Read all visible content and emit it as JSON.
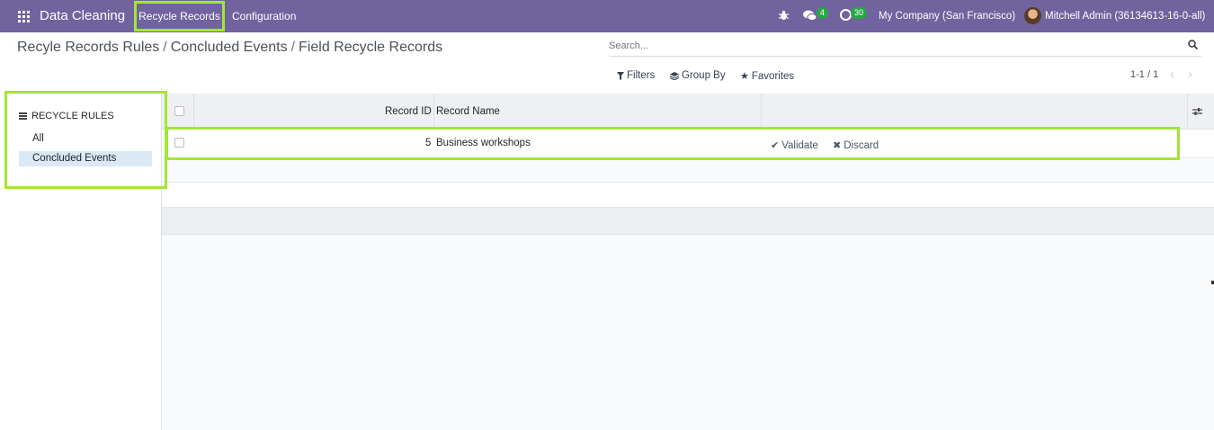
{
  "navbar": {
    "app_title": "Data Cleaning",
    "menu_recycle": "Recycle Records",
    "menu_config": "Configuration",
    "chat_count": "4",
    "activity_count": "30",
    "company": "My Company (San Francisco)",
    "user": "Mitchell Admin (36134613-16-0-all)"
  },
  "breadcrumb": {
    "items": [
      "Recyle Records Rules",
      "Concluded Events",
      "Field Recycle Records"
    ]
  },
  "search": {
    "placeholder": "Search..."
  },
  "filters": {
    "filters": "Filters",
    "group_by": "Group By",
    "favorites": "Favorites"
  },
  "pager": {
    "text": "1-1 / 1"
  },
  "side_panel": {
    "heading": "RECYCLE RULES",
    "items": [
      {
        "label": "All",
        "active": false
      },
      {
        "label": "Concluded Events",
        "active": true
      }
    ]
  },
  "table": {
    "columns": {
      "record_id": "Record ID",
      "record_name": "Record Name"
    },
    "rows": [
      {
        "record_id": "5",
        "record_name": "Business workshops",
        "validate": "Validate",
        "discard": "Discard"
      }
    ]
  },
  "colors": {
    "navbar": "#71639e",
    "highlight": "#a3e635",
    "active_item": "#dbe9f5"
  }
}
